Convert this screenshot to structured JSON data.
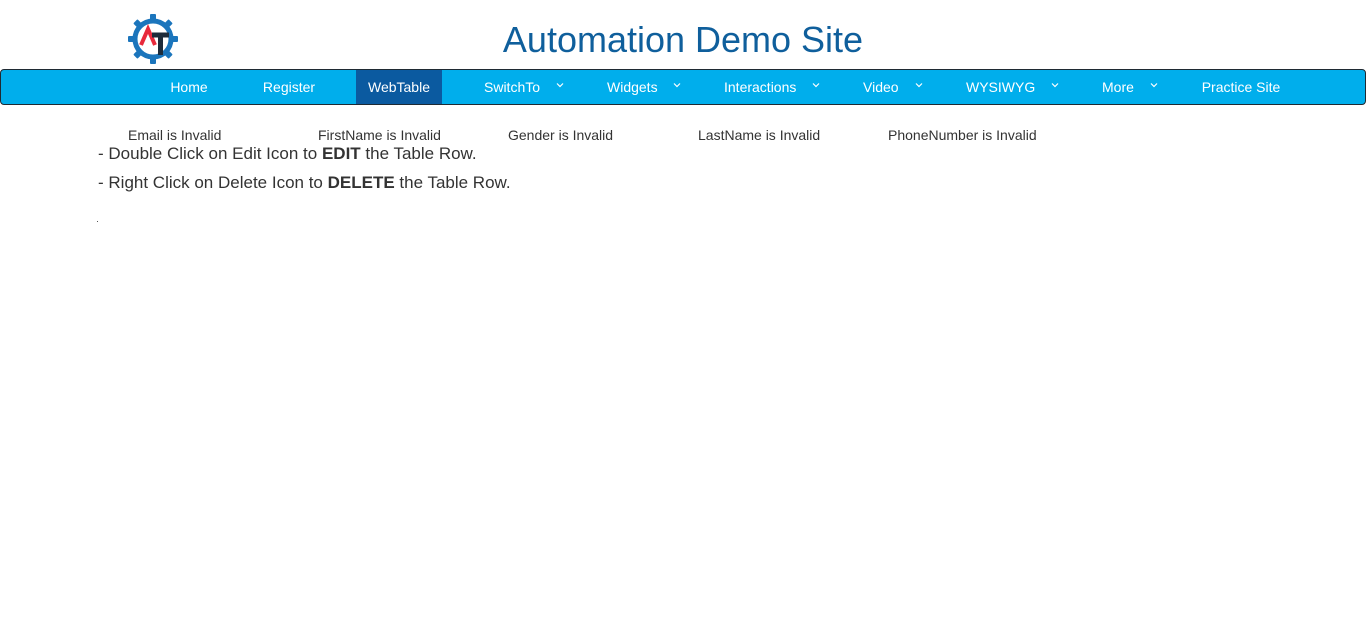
{
  "header": {
    "title": "Automation Demo Site",
    "logo_icon": "automation-testing-gear-logo"
  },
  "nav": {
    "items": [
      {
        "label": "Home",
        "has_dropdown": false,
        "active": false
      },
      {
        "label": "Register",
        "has_dropdown": false,
        "active": false
      },
      {
        "label": "WebTable",
        "has_dropdown": false,
        "active": true
      },
      {
        "label": "SwitchTo",
        "has_dropdown": true,
        "active": false
      },
      {
        "label": "Widgets",
        "has_dropdown": true,
        "active": false
      },
      {
        "label": "Interactions",
        "has_dropdown": true,
        "active": false
      },
      {
        "label": "Video",
        "has_dropdown": true,
        "active": false
      },
      {
        "label": "WYSIWYG",
        "has_dropdown": true,
        "active": false
      },
      {
        "label": "More",
        "has_dropdown": true,
        "active": false
      },
      {
        "label": "Practice Site",
        "has_dropdown": false,
        "active": false
      }
    ]
  },
  "validation": {
    "messages": [
      "Email is Invalid",
      "FirstName is Invalid",
      "Gender is Invalid",
      "LastName is Invalid",
      "PhoneNumber is Invalid"
    ]
  },
  "instructions": {
    "line1": {
      "prefix": "- Double Click on Edit Icon to ",
      "bold": "EDIT",
      "suffix": " the Table Row."
    },
    "line2": {
      "prefix": "- Right Click on Delete Icon to ",
      "bold": "DELETE",
      "suffix": " the Table Row."
    }
  },
  "colors": {
    "title": "#0f5f9c",
    "navbar": "#00aeec",
    "nav_active": "#0b5aa0",
    "logo_blue": "#1b75bc",
    "logo_red": "#e8293b",
    "logo_dark": "#1d2b3a"
  }
}
